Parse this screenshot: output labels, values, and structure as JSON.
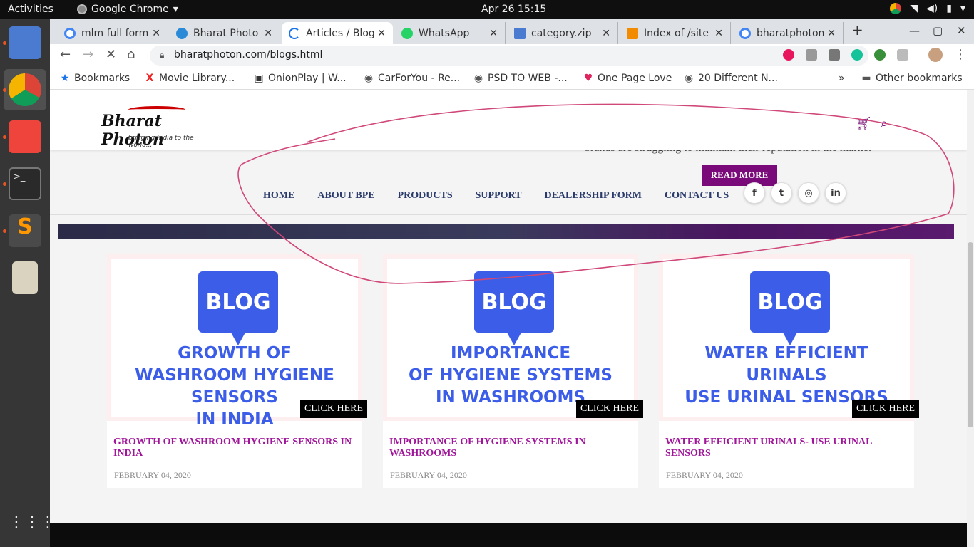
{
  "os": {
    "activities": "Activities",
    "app_name": "Google Chrome",
    "clock": "Apr 26  15:15"
  },
  "tabs": [
    {
      "label": "mlm full form",
      "close": "✕"
    },
    {
      "label": "Bharat Photo",
      "close": "✕"
    },
    {
      "label": "Articles / Blog",
      "close": "✕"
    },
    {
      "label": "WhatsApp",
      "close": "✕"
    },
    {
      "label": "category.zip",
      "close": "✕"
    },
    {
      "label": "Index of /site",
      "close": "✕"
    },
    {
      "label": "bharatphoton",
      "close": "✕"
    }
  ],
  "new_tab": "+",
  "address": {
    "url": "bharatphoton.com/blogs.html"
  },
  "bookmarks": [
    {
      "label": "Bookmarks",
      "icon": "★"
    },
    {
      "label": "Movie Library...",
      "icon": "X"
    },
    {
      "label": "OnionPlay | W...",
      "icon": "▣"
    },
    {
      "label": "CarForYou - Re...",
      "icon": "◉"
    },
    {
      "label": "PSD TO WEB -...",
      "icon": "◉"
    },
    {
      "label": "One Page Love",
      "icon": "♥"
    },
    {
      "label": "20 Different N...",
      "icon": "◉"
    }
  ],
  "other_bookmarks": "Other bookmarks",
  "site": {
    "logo_name": "Bharat Photon",
    "logo_tagline": "bringing India to the world...",
    "overlap_text": "brands are struggling to maintain their reputation in the market",
    "read_more": "READ MORE",
    "nav": [
      "HOME",
      "ABOUT BPE",
      "PRODUCTS",
      "SUPPORT",
      "DEALERSHIP FORM",
      "CONTACT US"
    ],
    "social": [
      "f",
      "t",
      "◎",
      "in"
    ],
    "cards": [
      {
        "badge": "BLOG",
        "image_lines": [
          "GROWTH OF",
          "WASHROOM HYGIENE SENSORS",
          "IN INDIA"
        ],
        "button": "CLICK HERE",
        "title": "GROWTH OF WASHROOM HYGIENE SENSORS IN INDIA",
        "date": "FEBRUARY 04, 2020"
      },
      {
        "badge": "BLOG",
        "image_lines": [
          "IMPORTANCE",
          "OF HYGIENE SYSTEMS",
          "IN WASHROOMS"
        ],
        "button": "CLICK HERE",
        "title": "IMPORTANCE OF HYGIENE SYSTEMS IN WASHROOMS",
        "date": "FEBRUARY 04, 2020"
      },
      {
        "badge": "BLOG",
        "image_lines": [
          "WATER EFFICIENT",
          "URINALS",
          "USE URINAL SENSORS"
        ],
        "button": "CLICK HERE",
        "title": "WATER EFFICIENT URINALS- USE URINAL SENSORS",
        "date": "FEBRUARY 04, 2020"
      }
    ]
  },
  "colors": {
    "brand_purple": "#7a0a7a",
    "blog_blue": "#3b5de7",
    "title_magenta": "#a0159a",
    "scribble": "#d0487a"
  }
}
